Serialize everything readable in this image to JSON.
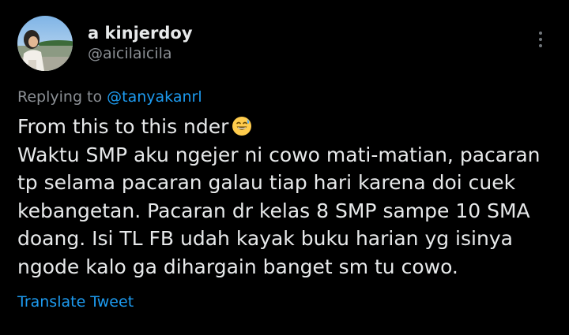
{
  "author": {
    "display_name": "a kinjerdoy",
    "handle": "@aicilaicila",
    "avatar_icon": "profile-photo"
  },
  "reply": {
    "prefix": "Replying to ",
    "mention": "@tanyakanrl"
  },
  "tweet": {
    "lines": [
      "From this to this nder",
      "Waktu SMP aku ngejer ni cowo mati-matian, pacaran",
      "tp selama pacaran galau tiap hari karena doi cuek",
      "kebangetan. Pacaran dr kelas 8 SMP sampe 10 SMA",
      "doang. Isi TL FB udah kayak buku harian yg isinya",
      "ngode kalo ga dihargain banget sm tu cowo."
    ],
    "emoji": "grinning-sweat-emoji"
  },
  "actions": {
    "translate_label": "Translate Tweet",
    "more_icon": "more-vertical-icon"
  },
  "colors": {
    "background": "#000000",
    "text_primary": "#e7e9ea",
    "text_secondary": "#8b8f94",
    "link": "#1d9bf0"
  }
}
